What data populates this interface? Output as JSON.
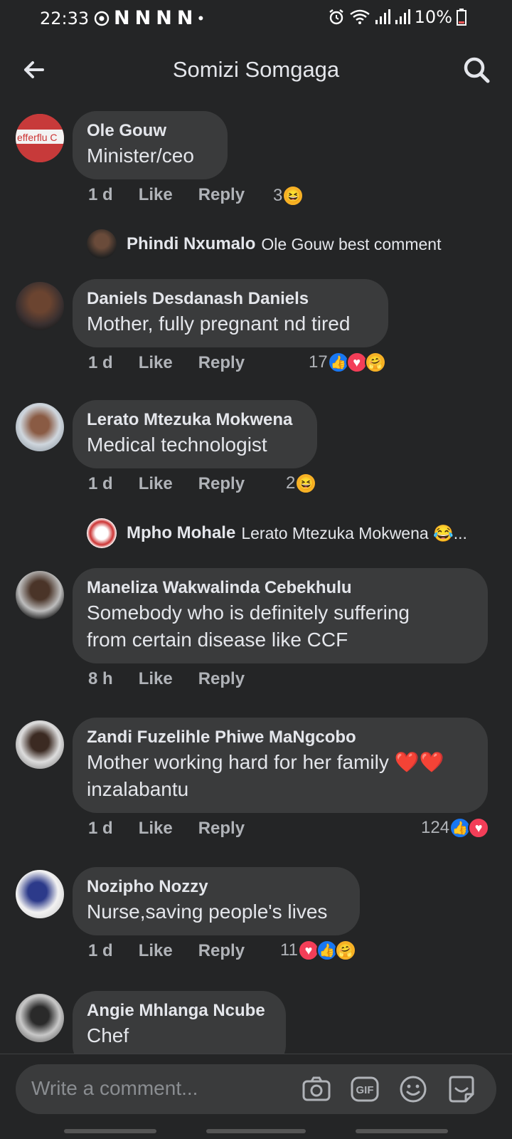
{
  "status": {
    "time": "22:33",
    "left_glyphs": [
      "N",
      "N",
      "N",
      "N"
    ],
    "dot": "•",
    "battery": "10%"
  },
  "header": {
    "title": "Somizi Somgaga"
  },
  "comments": [
    {
      "name": "Ole Gouw",
      "text": "Minister/ceo",
      "age": "1 d",
      "like": "Like",
      "reply": "Reply",
      "reaction_count": "3",
      "reactions": [
        "haha"
      ],
      "reply_preview": {
        "name": "Phindi Nxumalo",
        "text": "Ole Gouw best comment"
      }
    },
    {
      "name": "Daniels Desdanash Daniels",
      "text": "Mother, fully pregnant nd tired",
      "age": "1 d",
      "like": "Like",
      "reply": "Reply",
      "reaction_count": "17",
      "reactions": [
        "like",
        "love",
        "care"
      ]
    },
    {
      "name": "Lerato Mtezuka Mokwena",
      "text": "Medical technologist",
      "age": "1 d",
      "like": "Like",
      "reply": "Reply",
      "reaction_count": "2",
      "reactions": [
        "haha"
      ],
      "reply_preview": {
        "name": "Mpho Mohale",
        "text": "Lerato Mtezuka Mokwena 😂..."
      }
    },
    {
      "name": "Maneliza Wakwalinda Cebekhulu",
      "text_lines": [
        "Somebody who is definitely suffering",
        "from certain disease like CCF"
      ],
      "age": "8 h",
      "like": "Like",
      "reply": "Reply"
    },
    {
      "name": "Zandi Fuzelihle Phiwe MaNgcobo",
      "text_lines": [
        "Mother working hard for her family ❤️❤️",
        "inzalabantu"
      ],
      "age": "1 d",
      "like": "Like",
      "reply": "Reply",
      "reaction_count": "124",
      "reactions": [
        "like",
        "love"
      ]
    },
    {
      "name": "Nozipho Nozzy",
      "text": "Nurse,saving people's lives",
      "age": "1 d",
      "like": "Like",
      "reply": "Reply",
      "reaction_count": "11",
      "reactions": [
        "love",
        "like",
        "care"
      ]
    },
    {
      "name": "Angie Mhlanga Ncube",
      "text": "Chef"
    }
  ],
  "avatar_labels": {
    "ole_gouw_sign": "efferflu C"
  },
  "composer": {
    "placeholder": "Write a comment..."
  },
  "icons": {
    "back": "back-arrow-icon",
    "search": "search-icon",
    "camera": "camera-icon",
    "gif": "gif-icon",
    "emoji": "emoji-icon",
    "sticker": "sticker-icon"
  }
}
